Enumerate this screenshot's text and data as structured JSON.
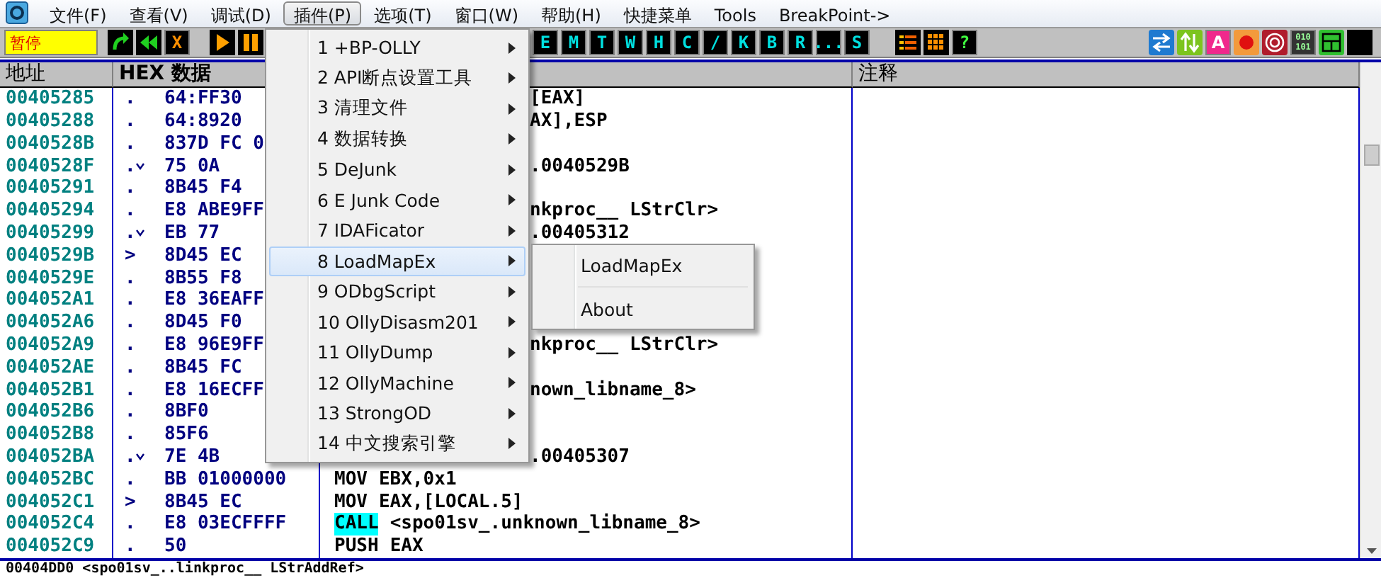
{
  "menu_bar": [
    {
      "label": "文件(F)",
      "selected": false
    },
    {
      "label": "查看(V)",
      "selected": false
    },
    {
      "label": "调试(D)",
      "selected": false
    },
    {
      "label": "插件(P)",
      "selected": true
    },
    {
      "label": "选项(T)",
      "selected": false
    },
    {
      "label": "窗口(W)",
      "selected": false
    },
    {
      "label": "帮助(H)",
      "selected": false
    },
    {
      "label": "快捷菜单",
      "selected": false
    },
    {
      "label": "Tools",
      "selected": false
    },
    {
      "label": "BreakPoint->",
      "selected": false
    }
  ],
  "toolbar": {
    "status": "暂停",
    "stop_button": "X",
    "letter_buttons": [
      "E",
      "M",
      "T",
      "W",
      "H",
      "C",
      "/",
      "K",
      "B",
      "R",
      "...",
      "S"
    ],
    "help_button": "?",
    "a_button": "A",
    "binary_lines": [
      "010",
      "101"
    ]
  },
  "header": {
    "address": "地址",
    "hex": "HEX 数据",
    "comment": "注释"
  },
  "rows": [
    {
      "address": "00405285",
      "marker": ".",
      "branch": false,
      "hex": "64:FF30",
      "kind": "covered",
      "disasm": "[EAX]"
    },
    {
      "address": "00405288",
      "marker": ".",
      "branch": false,
      "hex": "64:8920",
      "kind": "covered",
      "disasm": "AX],ESP"
    },
    {
      "address": "0040528B",
      "marker": ".",
      "branch": false,
      "hex": "837D FC 0",
      "kind": "covered"
    },
    {
      "address": "0040528F",
      "marker": ".",
      "branch": true,
      "hex": "75 0A",
      "kind": "covered",
      "disasm": ".0040529B"
    },
    {
      "address": "00405291",
      "marker": ".",
      "branch": false,
      "hex": "8B45 F4",
      "kind": "covered"
    },
    {
      "address": "00405294",
      "marker": ".",
      "branch": false,
      "hex": "E8 ABE9FF",
      "kind": "covered",
      "disasm": "nkproc__ LStrClr>"
    },
    {
      "address": "00405299",
      "marker": ".",
      "branch": true,
      "hex": "EB 77",
      "kind": "covered",
      "disasm": ".00405312"
    },
    {
      "address": "0040529B",
      "marker": ">",
      "branch": false,
      "hex": "8D45 EC",
      "kind": "covered"
    },
    {
      "address": "0040529E",
      "marker": ".",
      "branch": false,
      "hex": "8B55 F8",
      "kind": "covered"
    },
    {
      "address": "004052A1",
      "marker": ".",
      "branch": false,
      "hex": "E8 36EAFF",
      "kind": "covered"
    },
    {
      "address": "004052A6",
      "marker": ".",
      "branch": false,
      "hex": "8D45 F0",
      "kind": "covered"
    },
    {
      "address": "004052A9",
      "marker": ".",
      "branch": false,
      "hex": "E8 96E9FF",
      "kind": "covered",
      "disasm": "nkproc__ LStrClr>"
    },
    {
      "address": "004052AE",
      "marker": ".",
      "branch": false,
      "hex": "8B45 FC",
      "kind": "covered"
    },
    {
      "address": "004052B1",
      "marker": ".",
      "branch": false,
      "hex": "E8 16ECFF",
      "kind": "covered",
      "disasm": "nown_libname_8>"
    },
    {
      "address": "004052B6",
      "marker": ".",
      "branch": false,
      "hex": "8BF0",
      "kind": "covered"
    },
    {
      "address": "004052B8",
      "marker": ".",
      "branch": false,
      "hex": "85F6",
      "kind": "covered"
    },
    {
      "address": "004052BA",
      "marker": ".",
      "branch": true,
      "hex": "7E 4B",
      "kind": "covered",
      "disasm": ".00405307"
    },
    {
      "address": "004052BC",
      "marker": ".",
      "branch": false,
      "hex": "BB 01000000",
      "kind": "full",
      "mnemonic": "MOV",
      "operands": "EBX,0x1",
      "highlight": false
    },
    {
      "address": "004052C1",
      "marker": ">",
      "branch": false,
      "hex": "8B45 EC",
      "kind": "full",
      "mnemonic": "MOV",
      "operands": "EAX,[LOCAL.5]",
      "highlight": false
    },
    {
      "address": "004052C4",
      "marker": ".",
      "branch": false,
      "hex": "E8 03ECFFFF",
      "kind": "full",
      "mnemonic": "CALL",
      "operands": "<spo01sv_.unknown_libname_8>",
      "highlight": true
    },
    {
      "address": "004052C9",
      "marker": ".",
      "branch": false,
      "hex": "50",
      "kind": "full",
      "mnemonic": "PUSH",
      "operands": "EAX",
      "highlight": false
    }
  ],
  "info_line": "00404DD0 <spo01sv_..linkproc__ LStrAddRef>",
  "plugin_menu": [
    {
      "label": "1 +BP-OLLY",
      "selected": false
    },
    {
      "label": "2 API断点设置工具",
      "selected": false
    },
    {
      "label": "3 清理文件",
      "selected": false
    },
    {
      "label": "4 数据转换",
      "selected": false
    },
    {
      "label": "5 DeJunk",
      "selected": false
    },
    {
      "label": "6 E Junk Code",
      "selected": false
    },
    {
      "label": "7 IDAFicator",
      "selected": false
    },
    {
      "label": "8 LoadMapEx",
      "selected": true
    },
    {
      "label": "9 ODbgScript",
      "selected": false
    },
    {
      "label": "10 OllyDisasm201",
      "selected": false
    },
    {
      "label": "11 OllyDump",
      "selected": false
    },
    {
      "label": "12 OllyMachine",
      "selected": false
    },
    {
      "label": "13 StrongOD",
      "selected": false
    },
    {
      "label": "14 中文搜索引擎",
      "selected": false
    }
  ],
  "submenu": [
    "LoadMapEx",
    "About"
  ]
}
